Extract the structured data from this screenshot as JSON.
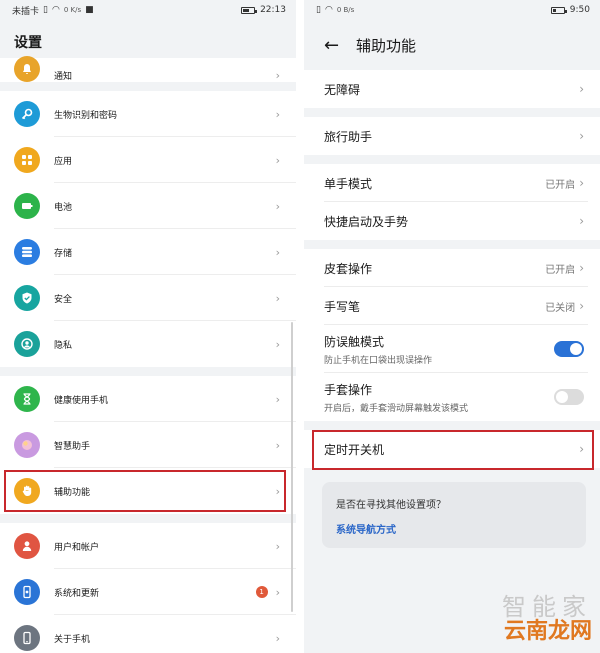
{
  "left": {
    "status": {
      "carrier": "未插卡",
      "speed": "0 K/s",
      "time": "22:13",
      "battery_level": 0.6
    },
    "page_title": "设置",
    "items": [
      {
        "label": "通知",
        "icon": "bell-icon",
        "color": "#e8a42a"
      },
      {
        "label": "生物识别和密码",
        "icon": "key-icon",
        "color": "#1e9bd7"
      },
      {
        "label": "应用",
        "icon": "apps-grid-icon",
        "color": "#f0a81e"
      },
      {
        "label": "电池",
        "icon": "battery-icon",
        "color": "#2cb34a"
      },
      {
        "label": "存储",
        "icon": "storage-icon",
        "color": "#2b7de1"
      },
      {
        "label": "安全",
        "icon": "shield-check-icon",
        "color": "#17a5a0"
      },
      {
        "label": "隐私",
        "icon": "privacy-icon",
        "color": "#1aa29a"
      },
      {
        "label": "健康使用手机",
        "icon": "hourglass-icon",
        "color": "#2fb54c"
      },
      {
        "label": "智慧助手",
        "icon": "assistant-orb-icon",
        "color": "#c99ae0"
      },
      {
        "label": "辅助功能",
        "icon": "hand-icon",
        "color": "#f0a820"
      },
      {
        "label": "用户和帐户",
        "icon": "user-icon",
        "color": "#e05542"
      },
      {
        "label": "系统和更新",
        "icon": "phone-update-icon",
        "color": "#2a74d6",
        "badge": "1"
      },
      {
        "label": "关于手机",
        "icon": "phone-icon",
        "color": "#6d7580"
      }
    ]
  },
  "right": {
    "status": {
      "speed": "0 B/s",
      "time": "9:50",
      "battery_level": 0.35
    },
    "title": "辅助功能",
    "groups": [
      {
        "items": [
          {
            "label": "无障碍"
          }
        ]
      },
      {
        "items": [
          {
            "label": "旅行助手"
          }
        ]
      },
      {
        "items": [
          {
            "label": "单手模式",
            "status": "已开启"
          },
          {
            "label": "快捷启动及手势"
          }
        ]
      },
      {
        "items": [
          {
            "label": "皮套操作",
            "status": "已开启"
          },
          {
            "label": "手写笔",
            "status": "已关闭"
          },
          {
            "label": "防误触模式",
            "sub": "防止手机在口袋出现误操作",
            "toggle": true
          },
          {
            "label": "手套操作",
            "sub": "开启后，戴手套滑动屏幕触发该模式",
            "toggle": false
          }
        ]
      },
      {
        "items": [
          {
            "label": "定时开关机"
          }
        ]
      }
    ],
    "suggestion": {
      "question": "是否在寻找其他设置项？",
      "link": "系统导航方式"
    }
  },
  "watermark": {
    "top": "智能家",
    "bottom": "云南龙网"
  },
  "colors": {
    "accent": "#2a72d6",
    "highlight": "#c8282c"
  }
}
